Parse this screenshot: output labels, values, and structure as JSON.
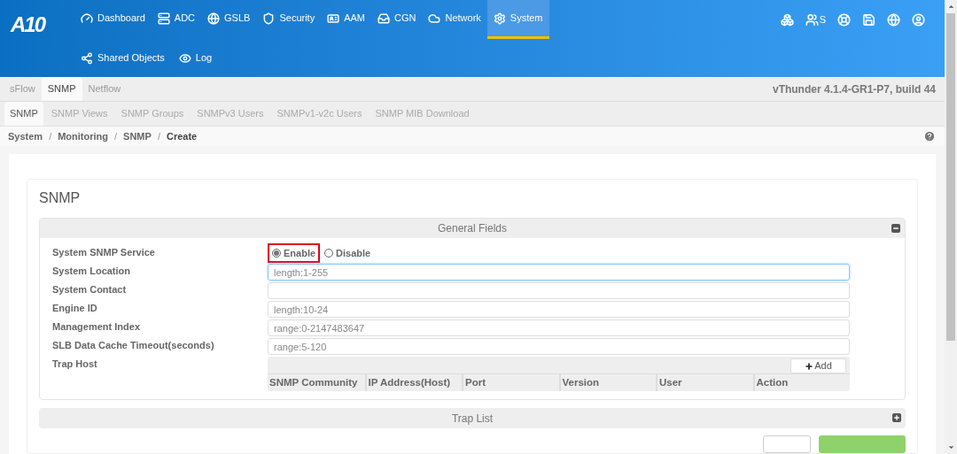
{
  "logo": "A10",
  "nav": [
    {
      "label": "Dashboard",
      "selected": false
    },
    {
      "label": "ADC",
      "selected": false
    },
    {
      "label": "GSLB",
      "selected": false
    },
    {
      "label": "Security",
      "selected": false
    },
    {
      "label": "AAM",
      "selected": false
    },
    {
      "label": "CGN",
      "selected": false
    },
    {
      "label": "Network",
      "selected": false
    },
    {
      "label": "System",
      "selected": true
    }
  ],
  "subnav": [
    "Shared Objects",
    "Log"
  ],
  "toolbar_user_label": "S",
  "tabs": [
    {
      "label": "sFlow",
      "selected": false
    },
    {
      "label": "SNMP",
      "selected": true
    },
    {
      "label": "Netflow",
      "selected": false
    }
  ],
  "version": "vThunder 4.1.4-GR1-P7, build 44",
  "subtabs": [
    {
      "label": "SNMP",
      "selected": true
    },
    {
      "label": "SNMP Views",
      "selected": false
    },
    {
      "label": "SNMP Groups",
      "selected": false
    },
    {
      "label": "SNMPv3 Users",
      "selected": false
    },
    {
      "label": "SNMPv1-v2c Users",
      "selected": false
    },
    {
      "label": "SNMP MIB Download",
      "selected": false
    }
  ],
  "breadcrumb": [
    {
      "kind": "link",
      "label": "System"
    },
    {
      "kind": "separator",
      "label": "/"
    },
    {
      "kind": "link",
      "label": "Monitoring"
    },
    {
      "kind": "separator",
      "label": "/"
    },
    {
      "kind": "link",
      "label": "SNMP"
    },
    {
      "kind": "separator",
      "label": "/"
    },
    {
      "kind": "current",
      "label": "Create"
    }
  ],
  "panel_title": "SNMP",
  "general": {
    "title": "General Fields",
    "expanded": true,
    "service": {
      "label": "System SNMP Service",
      "options": [
        {
          "label": "Enable",
          "selected": true,
          "highlighted": true
        },
        {
          "label": "Disable",
          "selected": false,
          "highlighted": false
        }
      ]
    },
    "fields": [
      {
        "label": "System Location",
        "placeholder": "length:1-255",
        "focused": true
      },
      {
        "label": "System Contact",
        "focused": false
      },
      {
        "label": "Engine ID",
        "placeholder": "length:10-24",
        "focused": false
      },
      {
        "label": "Management Index",
        "placeholder": "range:0-2147483647",
        "focused": false
      },
      {
        "label": "SLB Data Cache Timeout(seconds)",
        "placeholder": "range:5-120",
        "focused": false
      }
    ],
    "trap_host": {
      "label": "Trap Host",
      "add": "Add",
      "columns": [
        "SNMP Community",
        "IP Address(Host)",
        "Port",
        "Version",
        "User",
        "Action"
      ]
    }
  },
  "trap_list": {
    "title": "Trap List",
    "expanded": false
  }
}
